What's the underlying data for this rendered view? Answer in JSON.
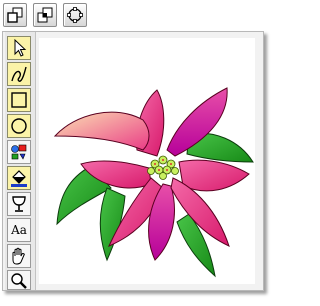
{
  "top_toolbar": {
    "buttons": [
      {
        "icon": "bring-to-front-icon"
      },
      {
        "icon": "send-to-back-icon"
      },
      {
        "icon": "rotate-icon"
      }
    ]
  },
  "tools": [
    {
      "icon": "arrow-select-icon",
      "active": true
    },
    {
      "icon": "freehand-curve-icon",
      "active": true
    },
    {
      "icon": "rectangle-icon",
      "active": true
    },
    {
      "icon": "ellipse-icon",
      "active": true
    },
    {
      "icon": "color-palette-icon",
      "active": false
    },
    {
      "icon": "paint-bucket-icon",
      "active": true
    },
    {
      "icon": "goblet-icon",
      "active": false
    },
    {
      "icon": "text-tool-icon",
      "active": false,
      "label": "Aa"
    },
    {
      "icon": "hand-pan-icon",
      "active": false
    },
    {
      "icon": "magnifier-icon",
      "active": false
    }
  ],
  "canvas": {
    "image": "poinsettia-flower-illustration",
    "colors": {
      "bract_pink": "#e61f7a",
      "bract_light": "#f9d3a8",
      "bract_magenta": "#c000a8",
      "leaf_green": "#2ea82e",
      "center_yellow_green": "#c8f060"
    }
  }
}
